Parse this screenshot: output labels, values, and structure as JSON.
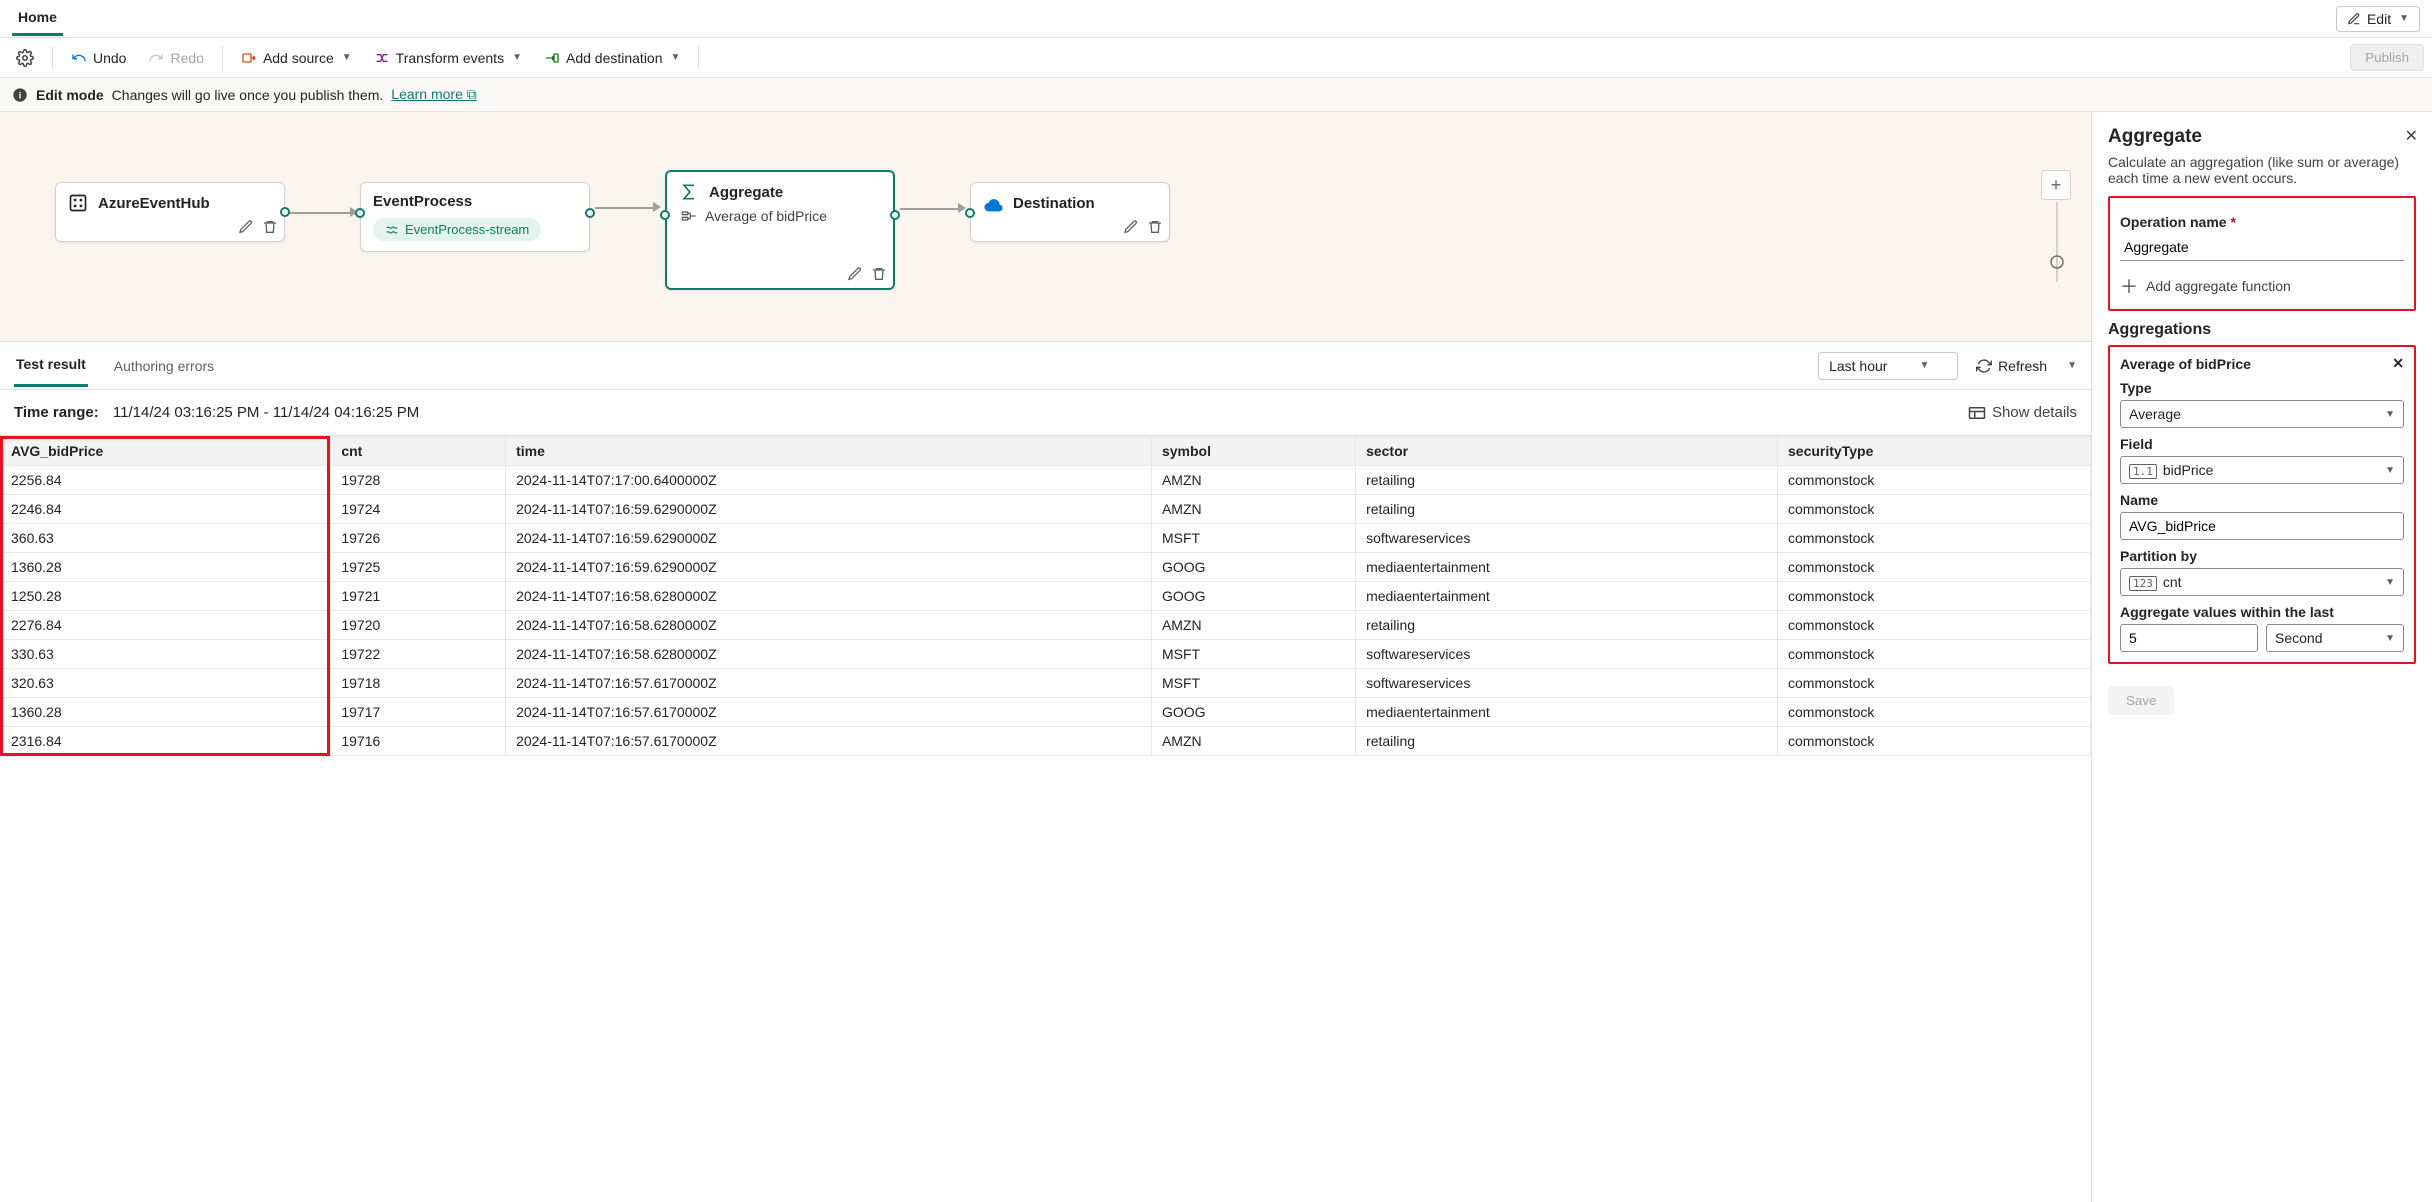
{
  "topbar": {
    "home_tab": "Home",
    "edit_btn": "Edit"
  },
  "toolbar": {
    "undo": "Undo",
    "redo": "Redo",
    "add_source": "Add source",
    "transform": "Transform events",
    "add_dest": "Add destination",
    "publish": "Publish"
  },
  "infobar": {
    "mode": "Edit mode",
    "msg": "Changes will go live once you publish them.",
    "learn": "Learn more"
  },
  "nodes": {
    "src": {
      "title": "AzureEventHub"
    },
    "proc": {
      "title": "EventProcess",
      "stream": "EventProcess-stream"
    },
    "agg": {
      "title": "Aggregate",
      "sub": "Average of bidPrice"
    },
    "dest": {
      "title": "Destination"
    }
  },
  "results": {
    "tab_test": "Test result",
    "tab_auth": "Authoring errors",
    "range_sel": "Last hour",
    "refresh": "Refresh",
    "time_label": "Time range:",
    "time_value": "11/14/24 03:16:25 PM - 11/14/24 04:16:25 PM",
    "show_details": "Show details",
    "columns": [
      "AVG_bidPrice",
      "cnt",
      "time",
      "symbol",
      "sector",
      "securityType"
    ],
    "rows": [
      [
        "2256.84",
        "19728",
        "2024-11-14T07:17:00.6400000Z",
        "AMZN",
        "retailing",
        "commonstock"
      ],
      [
        "2246.84",
        "19724",
        "2024-11-14T07:16:59.6290000Z",
        "AMZN",
        "retailing",
        "commonstock"
      ],
      [
        "360.63",
        "19726",
        "2024-11-14T07:16:59.6290000Z",
        "MSFT",
        "softwareservices",
        "commonstock"
      ],
      [
        "1360.28",
        "19725",
        "2024-11-14T07:16:59.6290000Z",
        "GOOG",
        "mediaentertainment",
        "commonstock"
      ],
      [
        "1250.28",
        "19721",
        "2024-11-14T07:16:58.6280000Z",
        "GOOG",
        "mediaentertainment",
        "commonstock"
      ],
      [
        "2276.84",
        "19720",
        "2024-11-14T07:16:58.6280000Z",
        "AMZN",
        "retailing",
        "commonstock"
      ],
      [
        "330.63",
        "19722",
        "2024-11-14T07:16:58.6280000Z",
        "MSFT",
        "softwareservices",
        "commonstock"
      ],
      [
        "320.63",
        "19718",
        "2024-11-14T07:16:57.6170000Z",
        "MSFT",
        "softwareservices",
        "commonstock"
      ],
      [
        "1360.28",
        "19717",
        "2024-11-14T07:16:57.6170000Z",
        "GOOG",
        "mediaentertainment",
        "commonstock"
      ],
      [
        "2316.84",
        "19716",
        "2024-11-14T07:16:57.6170000Z",
        "AMZN",
        "retailing",
        "commonstock"
      ]
    ]
  },
  "panel": {
    "title": "Aggregate",
    "desc": "Calculate an aggregation (like sum or average) each time a new event occurs.",
    "op_name_label": "Operation name",
    "op_name_value": "Aggregate",
    "add_fn": "Add aggregate function",
    "aggs_heading": "Aggregations",
    "agg_item_title": "Average of bidPrice",
    "type_label": "Type",
    "type_value": "Average",
    "field_label": "Field",
    "field_value": "bidPrice",
    "name_label": "Name",
    "name_value": "AVG_bidPrice",
    "partition_label": "Partition by",
    "partition_value": "cnt",
    "window_label": "Aggregate values within the last",
    "window_num": "5",
    "window_unit": "Second",
    "save": "Save"
  }
}
